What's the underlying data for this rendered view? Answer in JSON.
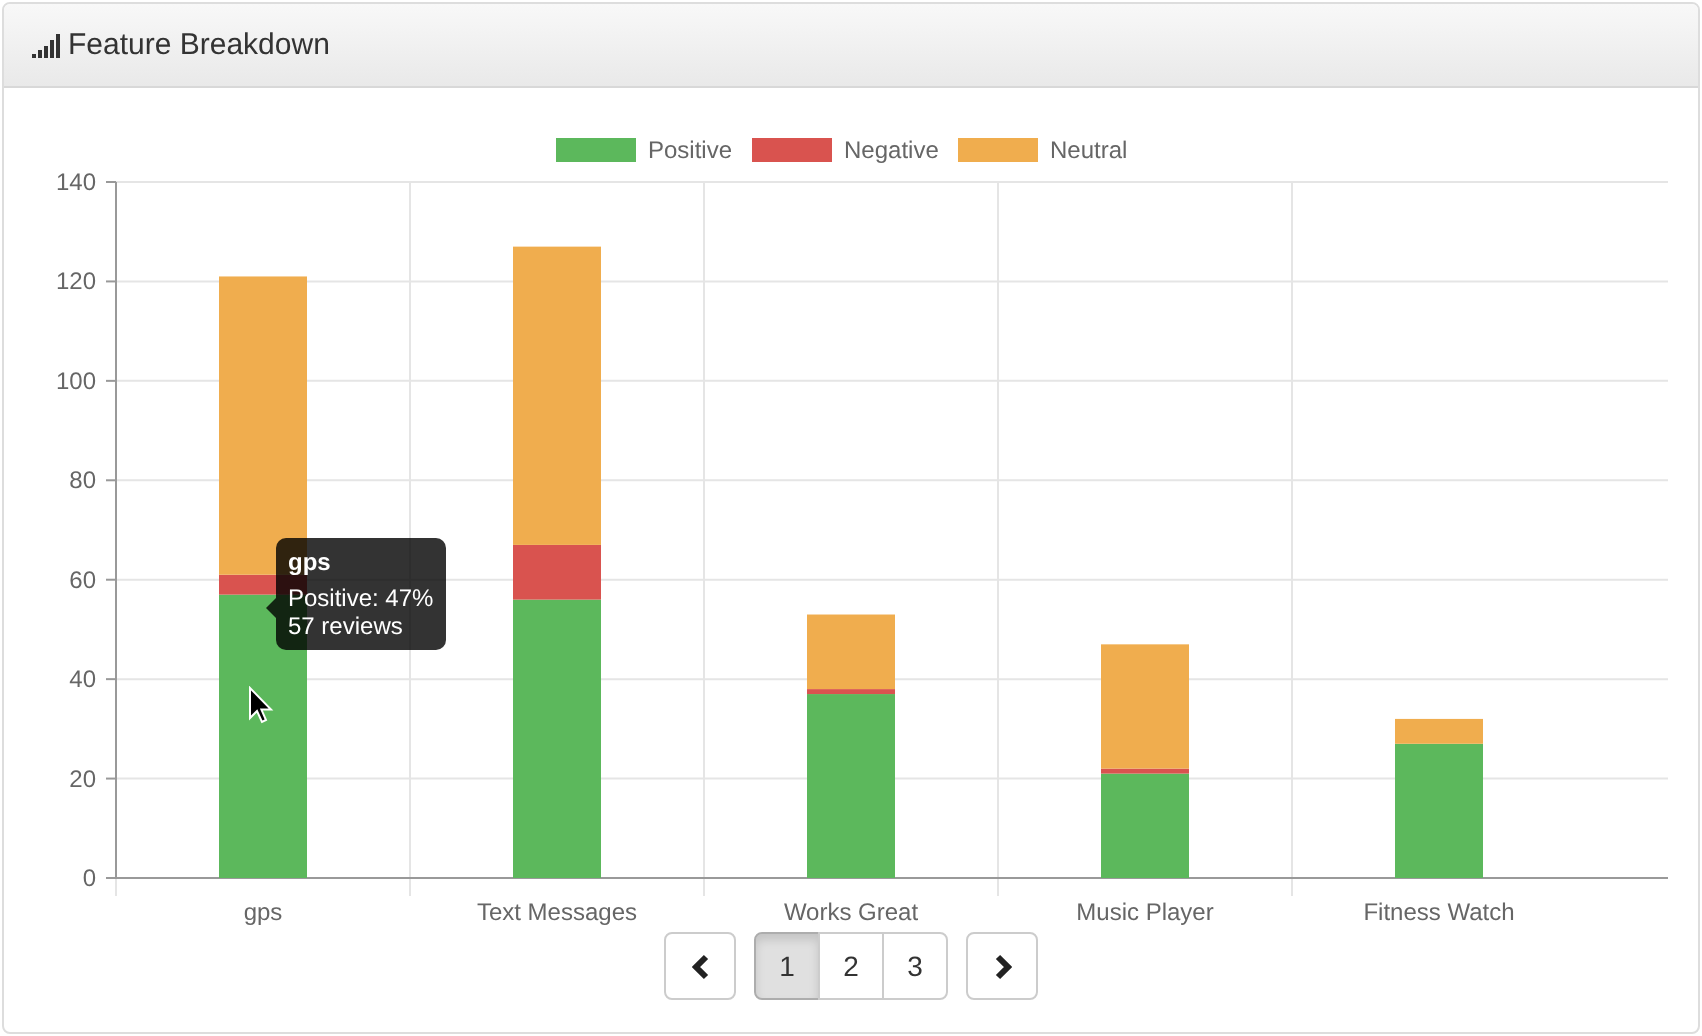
{
  "panel": {
    "title": "Feature Breakdown"
  },
  "chart": {
    "chart_data": {
      "type": "bar",
      "stacked": true,
      "categories": [
        "gps",
        "Text Messages",
        "Works Great",
        "Music Player",
        "Fitness Watch"
      ],
      "series": [
        {
          "name": "Positive",
          "color": "#5cb85c",
          "values": [
            57,
            56,
            37,
            21,
            27
          ]
        },
        {
          "name": "Negative",
          "color": "#d9534f",
          "values": [
            4,
            11,
            1,
            1,
            0
          ]
        },
        {
          "name": "Neutral",
          "color": "#f0ad4e",
          "values": [
            60,
            60,
            15,
            25,
            5
          ]
        }
      ],
      "ylim": [
        0,
        140
      ],
      "yticks": [
        0,
        20,
        40,
        60,
        80,
        100,
        120,
        140
      ],
      "grid": true,
      "legend": true
    },
    "tooltip": {
      "title": "gps",
      "lines": [
        "Positive: 47%",
        "57 reviews"
      ]
    }
  },
  "pagination": {
    "pages": [
      {
        "label": "1",
        "selected": true
      },
      {
        "label": "2",
        "selected": false
      },
      {
        "label": "3",
        "selected": false
      }
    ]
  }
}
